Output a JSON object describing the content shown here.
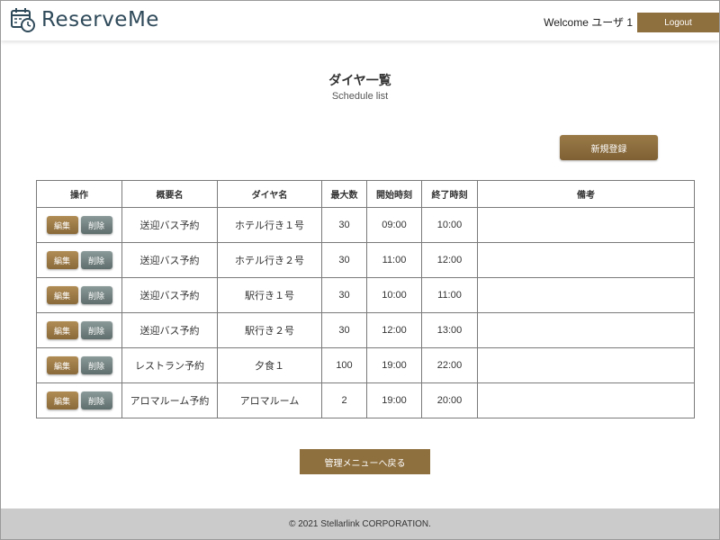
{
  "app": {
    "name": "ReserveMe"
  },
  "header": {
    "welcome": "Welcome ユーザ 1",
    "logout_label": "Logout"
  },
  "page": {
    "title": "ダイヤ一覧",
    "subtitle": "Schedule list"
  },
  "actions": {
    "new_label": "新規登録",
    "back_label": "管理メニューへ戻る"
  },
  "table": {
    "headers": [
      "操作",
      "概要名",
      "ダイヤ名",
      "最大数",
      "開始時刻",
      "終了時刻",
      "備考"
    ],
    "edit_label": "編集",
    "delete_label": "削除",
    "rows": [
      {
        "summary": "送迎バス予約",
        "name": "ホテル行き１号",
        "max": "30",
        "start": "09:00",
        "end": "10:00",
        "note": ""
      },
      {
        "summary": "送迎バス予約",
        "name": "ホテル行き２号",
        "max": "30",
        "start": "11:00",
        "end": "12:00",
        "note": ""
      },
      {
        "summary": "送迎バス予約",
        "name": "駅行き１号",
        "max": "30",
        "start": "10:00",
        "end": "11:00",
        "note": ""
      },
      {
        "summary": "送迎バス予約",
        "name": "駅行き２号",
        "max": "30",
        "start": "12:00",
        "end": "13:00",
        "note": ""
      },
      {
        "summary": "レストラン予約",
        "name": "夕食１",
        "max": "100",
        "start": "19:00",
        "end": "22:00",
        "note": ""
      },
      {
        "summary": "アロマルーム予約",
        "name": "アロマルーム",
        "max": "2",
        "start": "19:00",
        "end": "20:00",
        "note": ""
      }
    ]
  },
  "footer": {
    "copyright": "© 2021 Stellarlink CORPORATION."
  },
  "colors": {
    "accent": "#8e6f3e",
    "delete": "#6f7f7d",
    "footer": "#cbcbcb",
    "logo": "#2f4a5a"
  },
  "icons": {
    "logo": "calendar-clock-icon"
  }
}
